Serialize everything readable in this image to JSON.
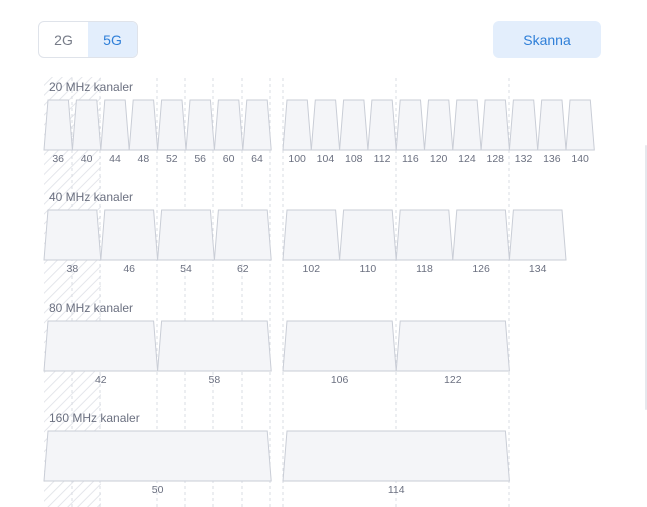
{
  "band_toggle": {
    "options": [
      "2G",
      "5G"
    ],
    "selected": "5G"
  },
  "scan_label": "Skanna",
  "rows": [
    {
      "label": "20 MHz kanaler",
      "channels": [
        36,
        40,
        44,
        48,
        52,
        56,
        60,
        64,
        100,
        104,
        108,
        112,
        116,
        120,
        124,
        128,
        132,
        136,
        140
      ]
    },
    {
      "label": "40 MHz kanaler",
      "channels": [
        38,
        46,
        54,
        62,
        102,
        110,
        118,
        126,
        134
      ]
    },
    {
      "label": "80 MHz kanaler",
      "channels": [
        42,
        58,
        106,
        122
      ]
    },
    {
      "label": "160 MHz kanaler",
      "channels": [
        50,
        114
      ]
    }
  ],
  "colors": {
    "accent": "#2f7fd8",
    "accent_bg": "#e3eefc",
    "channel_fill": "#f4f5f8",
    "channel_stroke": "#c9cdd6"
  }
}
